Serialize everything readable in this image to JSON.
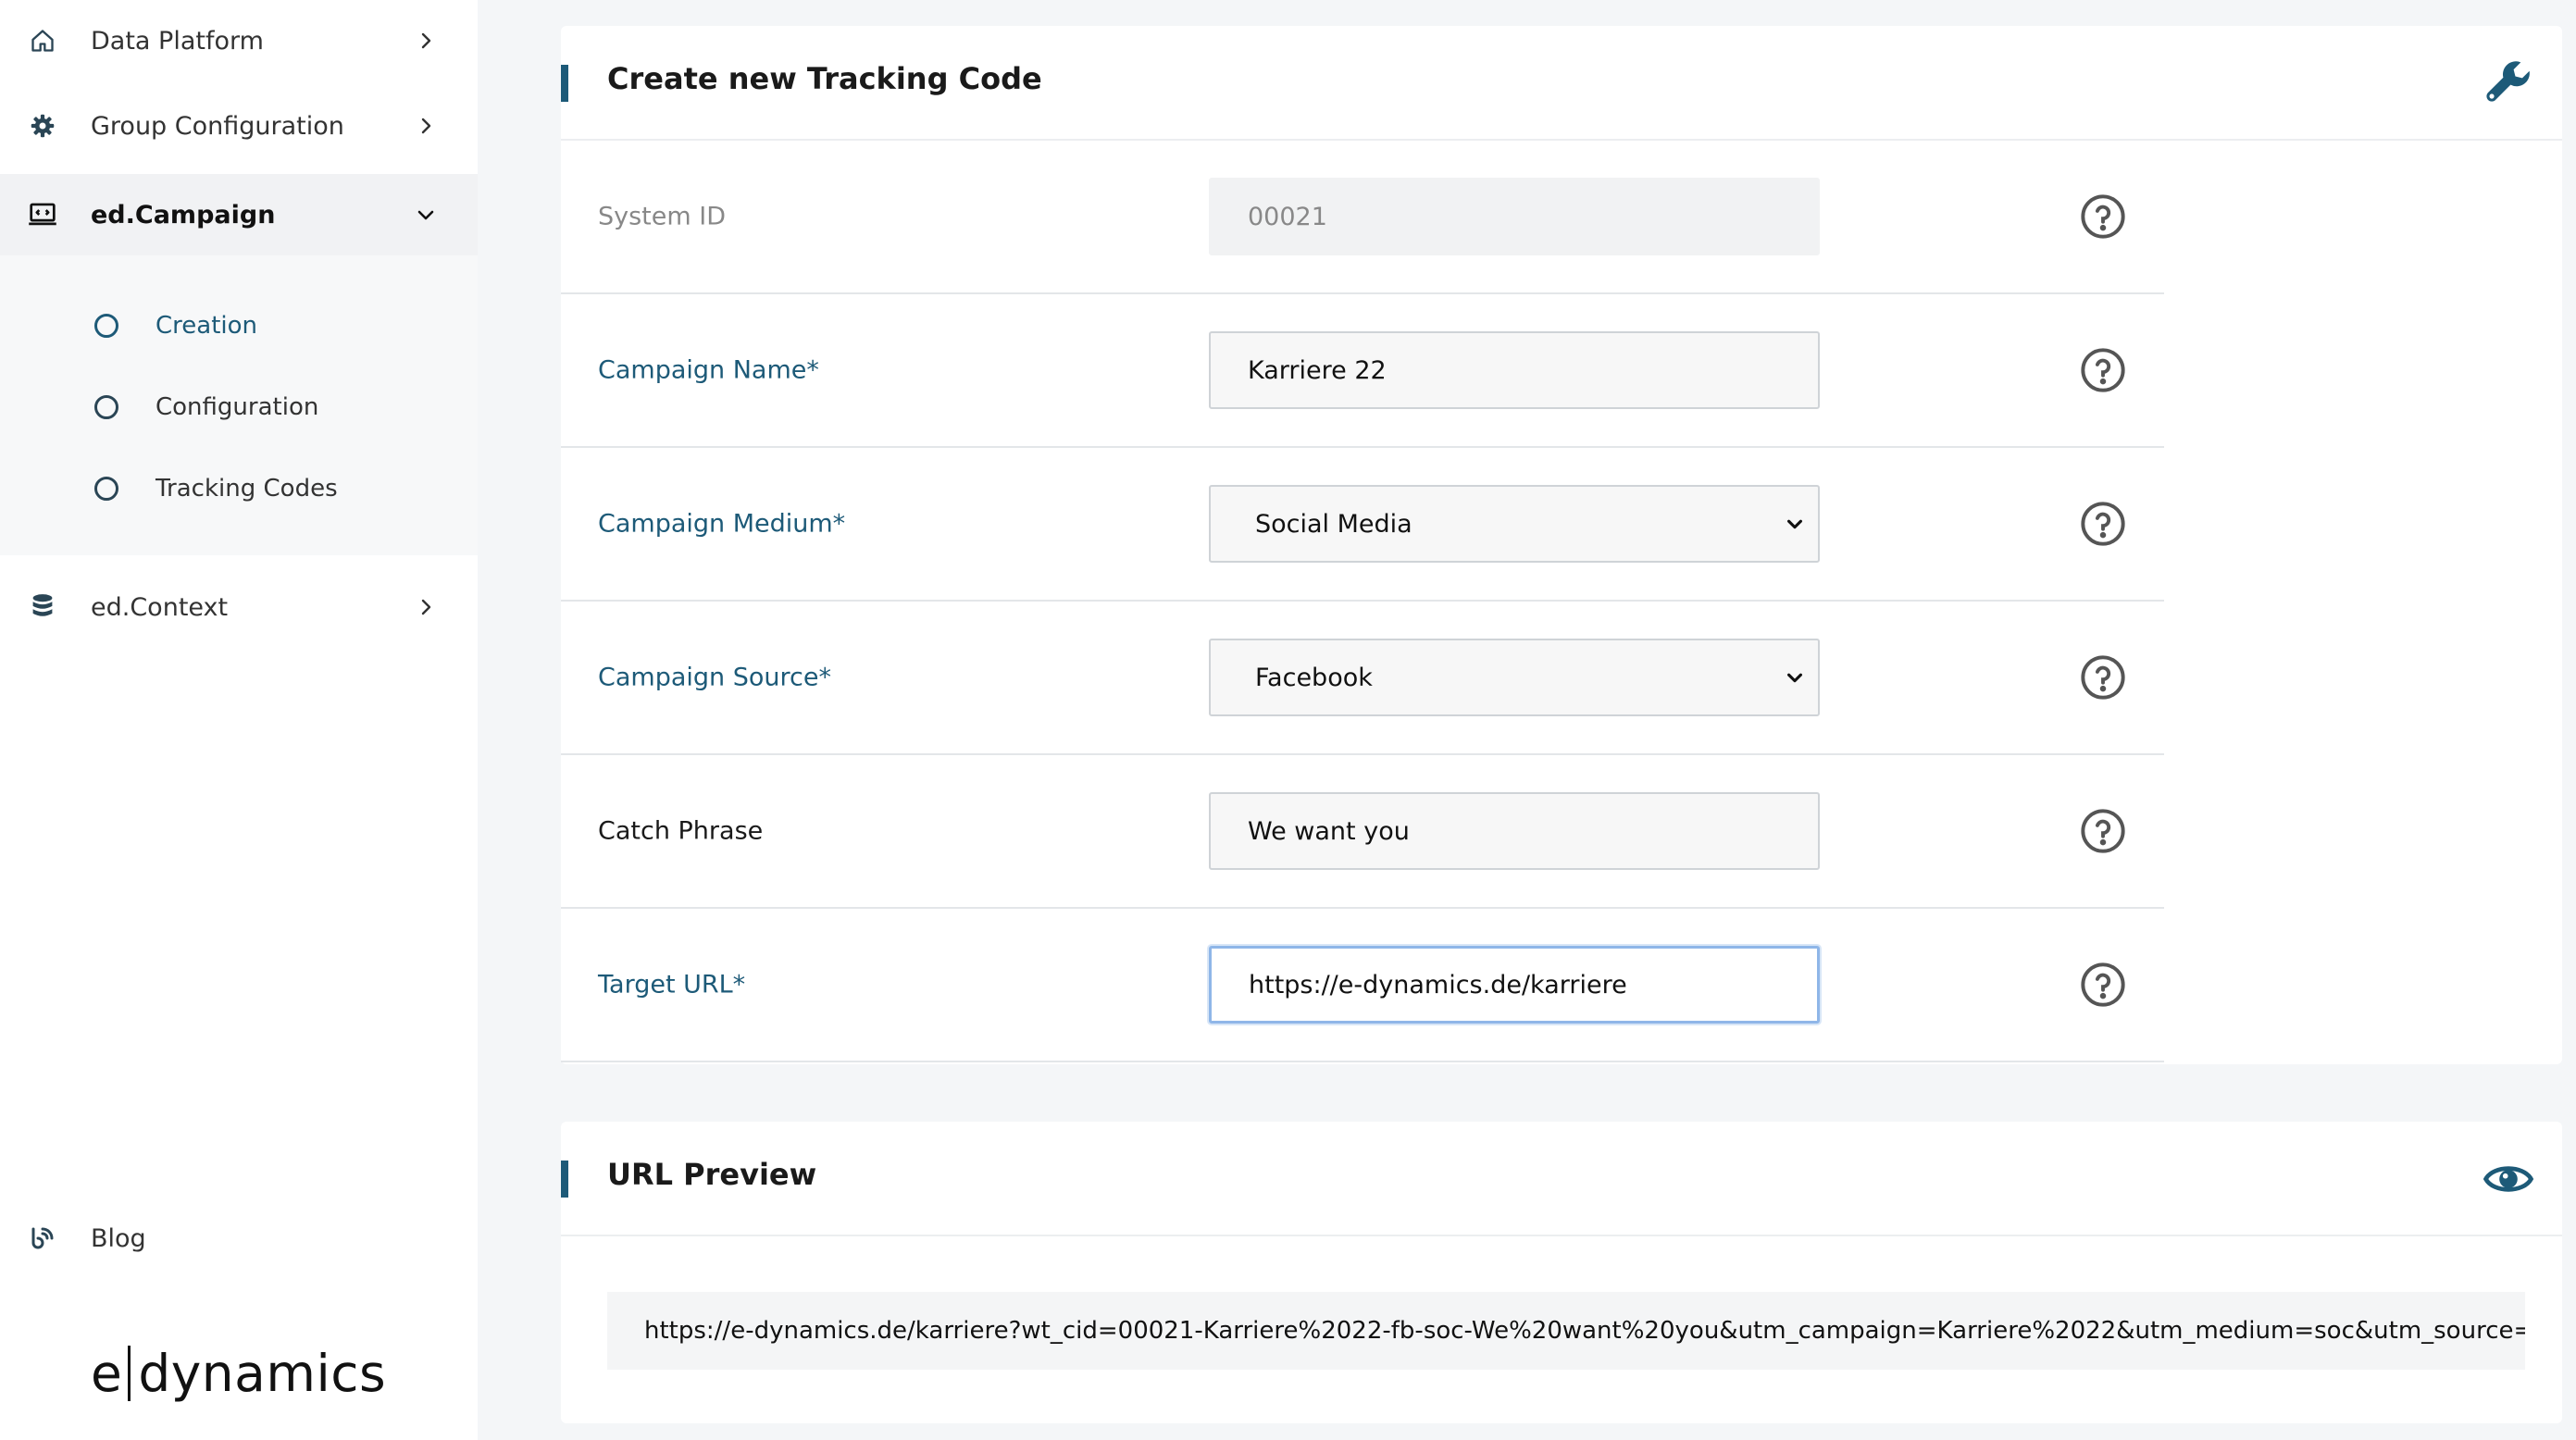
{
  "sidebar": {
    "items": [
      {
        "label": "Data Platform",
        "icon": "home-icon"
      },
      {
        "label": "Group Configuration",
        "icon": "gear-icon"
      },
      {
        "label": "ed.Campaign",
        "icon": "monitor-icon",
        "expanded": true
      },
      {
        "label": "ed.Context",
        "icon": "database-icon"
      },
      {
        "label": "Blog",
        "icon": "blog-feed-icon"
      }
    ],
    "campaign_sub": [
      {
        "label": "Creation",
        "active": true
      },
      {
        "label": "Configuration",
        "active": false
      },
      {
        "label": "Tracking Codes",
        "active": false
      }
    ],
    "logo": {
      "left": "e",
      "right": "dynamics"
    }
  },
  "form": {
    "title": "Create new Tracking Code",
    "header_icon": "wrench-icon",
    "rows": [
      {
        "label": "System ID",
        "value": "00021",
        "kind": "readonly"
      },
      {
        "label": "Campaign Name*",
        "value": "Karriere 22",
        "kind": "text"
      },
      {
        "label": "Campaign Medium*",
        "value": "Social Media",
        "kind": "select"
      },
      {
        "label": "Campaign Source*",
        "value": "Facebook",
        "kind": "select"
      },
      {
        "label": "Catch Phrase",
        "value": "We want you",
        "kind": "text"
      },
      {
        "label": "Target URL*",
        "value": "https://e-dynamics.de/karriere",
        "kind": "text"
      }
    ]
  },
  "preview": {
    "title": "URL Preview",
    "header_icon": "eye-icon",
    "url": "https://e-dynamics.de/karriere?wt_cid=00021-Karriere%2022-fb-soc-We%20want%20you&utm_campaign=Karriere%2022&utm_medium=soc&utm_source=fb&utm_"
  },
  "colors": {
    "accent": "#1d5a78",
    "page_bg": "#f4f6f8",
    "focus_border": "#8fb6e8"
  }
}
